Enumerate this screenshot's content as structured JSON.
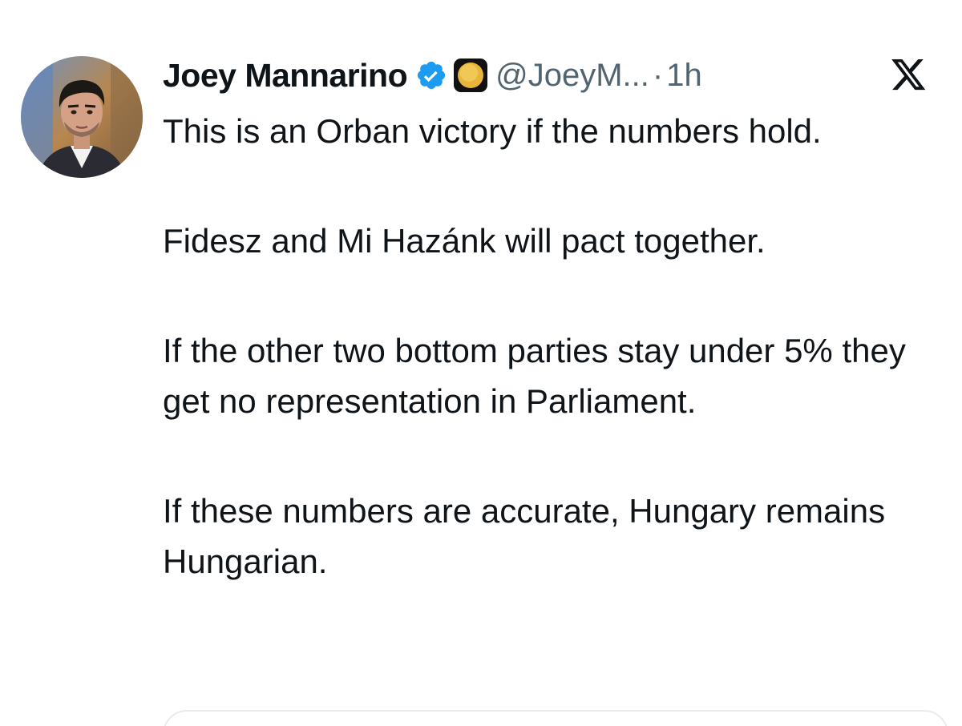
{
  "author": {
    "display_name": "Joey Mannarino",
    "handle": "@JoeyM...",
    "separator": "·",
    "timestamp": "1h",
    "verified_badge_icon": "verified-checkmark-icon",
    "emoji_icon": "coin-emoji-icon"
  },
  "platform": {
    "logo_icon": "x-logo-icon"
  },
  "tweet": {
    "paragraphs": [
      "This is an Orban victory if the numbers hold.",
      "Fidesz and Mi Hazánk will pact together.",
      "If the other two bottom parties stay under 5% they get no representation in Parliament.",
      "If these numbers are accurate, Hungary remains Hungarian."
    ]
  },
  "colors": {
    "text": "#0f1419",
    "secondary": "#536471",
    "verified_blue": "#1d9bf0",
    "border": "#e6ecf0"
  }
}
